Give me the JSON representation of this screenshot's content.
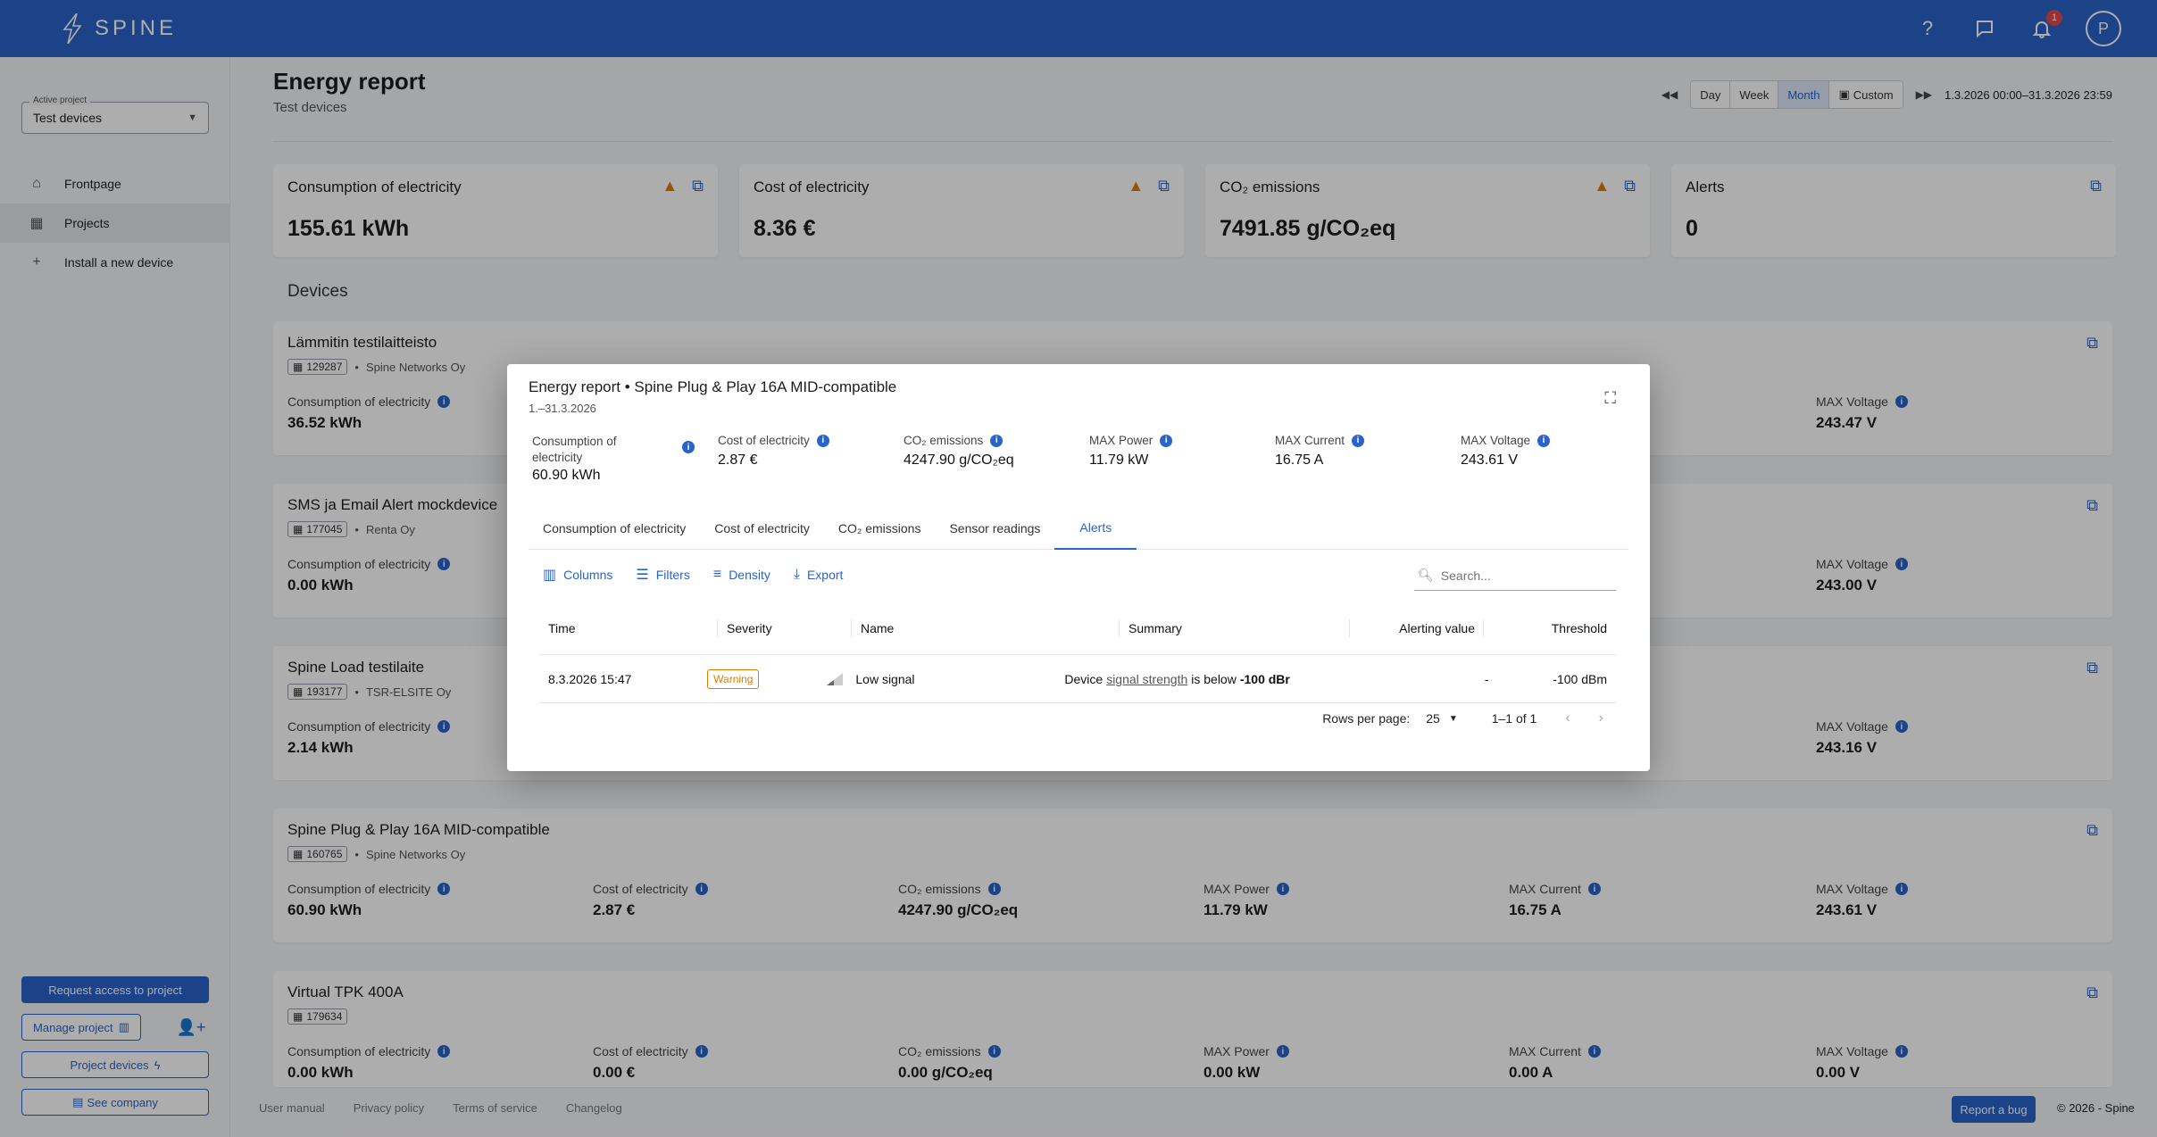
{
  "topbar": {
    "brand": "SPINE",
    "notification_count": "1",
    "avatar_initial": "P"
  },
  "sidebar": {
    "project_label": "Active project",
    "project_value": "Test devices",
    "items": [
      {
        "label": "Frontpage"
      },
      {
        "label": "Projects"
      },
      {
        "label": "Install a new device"
      }
    ],
    "request_access": "Request access to project",
    "manage_project": "Manage project",
    "project_devices": "Project devices",
    "see_company": "See company"
  },
  "header": {
    "title": "Energy report",
    "subtitle": "Test devices",
    "ranges": [
      "Day",
      "Week",
      "Month",
      "Custom"
    ],
    "selected_range": "Month",
    "date_range": "1.3.2026 00:00–31.3.2026 23:59"
  },
  "kpis": [
    {
      "title": "Consumption of electricity",
      "value": "155.61 kWh"
    },
    {
      "title": "Cost of electricity",
      "value": "8.36 €"
    },
    {
      "title": "CO₂ emissions",
      "value": "7491.85 g/CO₂eq"
    },
    {
      "title": "Alerts",
      "value": "0"
    }
  ],
  "devices_heading": "Devices",
  "metric_labels": {
    "consumption": "Consumption of electricity",
    "cost": "Cost of electricity",
    "co2": "CO₂ emissions",
    "power": "MAX Power",
    "current": "MAX Current",
    "voltage": "MAX Voltage"
  },
  "devices": [
    {
      "name": "Lämmitin testilaitteisto",
      "id": "129287",
      "company": "Spine Networks Oy",
      "consumption": "36.52 kWh",
      "cost": "",
      "co2": "",
      "power": "",
      "current": "",
      "voltage": "243.47 V"
    },
    {
      "name": "SMS ja Email Alert mockdevice",
      "id": "177045",
      "company": "Renta Oy",
      "consumption": "0.00 kWh",
      "cost": "",
      "co2": "",
      "power": "",
      "current": "",
      "voltage": "243.00 V"
    },
    {
      "name": "Spine Load testilaite",
      "id": "193177",
      "company": "TSR-ELSITE Oy",
      "consumption": "2.14 kWh",
      "cost": "",
      "co2": "",
      "power": "",
      "current": "",
      "voltage": "243.16 V"
    },
    {
      "name": "Spine Plug & Play 16A MID-compatible",
      "id": "160765",
      "company": "Spine Networks Oy",
      "consumption": "60.90 kWh",
      "cost": "2.87 €",
      "co2": "4247.90 g/CO₂eq",
      "power": "11.79 kW",
      "current": "16.75 A",
      "voltage": "243.61 V"
    },
    {
      "name": "Virtual TPK 400A",
      "id": "179634",
      "company": "",
      "consumption": "0.00 kWh",
      "cost": "0.00 €",
      "co2": "0.00 g/CO₂eq",
      "power": "0.00 kW",
      "current": "0.00 A",
      "voltage": "0.00 V"
    }
  ],
  "footer": {
    "links": [
      "User manual",
      "Privacy policy",
      "Terms of service",
      "Changelog"
    ],
    "report_bug": "Report a bug",
    "copyright": "© 2026 - Spine"
  },
  "modal": {
    "title": "Energy report • Spine Plug & Play 16A MID-compatible",
    "date": "1.–31.3.2026",
    "metrics": [
      {
        "label": "Consumption of electricity",
        "value": "60.90 kWh"
      },
      {
        "label": "Cost of electricity",
        "value": "2.87 €"
      },
      {
        "label": "CO₂ emissions",
        "value": "4247.90 g/CO₂eq"
      },
      {
        "label": "MAX Power",
        "value": "11.79 kW"
      },
      {
        "label": "MAX Current",
        "value": "16.75 A"
      },
      {
        "label": "MAX Voltage",
        "value": "243.61 V"
      }
    ],
    "tabs": [
      "Consumption of electricity",
      "Cost of electricity",
      "CO₂ emissions",
      "Sensor readings",
      "Alerts"
    ],
    "active_tab": "Alerts",
    "toolbar": {
      "columns": "Columns",
      "filters": "Filters",
      "density": "Density",
      "export": "Export"
    },
    "search_placeholder": "Search...",
    "columns": [
      "Time",
      "Severity",
      "Name",
      "Summary",
      "Alerting value",
      "Threshold"
    ],
    "rows": [
      {
        "time": "8.3.2026 15:47",
        "severity": "Warning",
        "name": "Low signal",
        "summary_pre": "Device",
        "summary_link": "signal strength",
        "summary_mid": "is below",
        "summary_bold": "-100 dBr",
        "alerting_value": "-",
        "threshold": "-100 dBm"
      }
    ],
    "pager": {
      "rows_per_page_label": "Rows per page:",
      "rows_per_page": "25",
      "range": "1–1 of 1"
    }
  },
  "colors": {
    "brand": "#2a64c9",
    "warning": "#e07b00"
  },
  "icons": [
    "logo-bolt-icon",
    "help-icon",
    "chat-icon",
    "bell-icon",
    "home-icon",
    "building-icon",
    "plus-icon",
    "warning-icon",
    "open-external-icon",
    "info-icon",
    "expand-icon",
    "columns-icon",
    "filter-icon",
    "density-icon",
    "export-icon",
    "search-icon",
    "signal-icon",
    "chevron-left-icon",
    "chevron-right-icon"
  ]
}
